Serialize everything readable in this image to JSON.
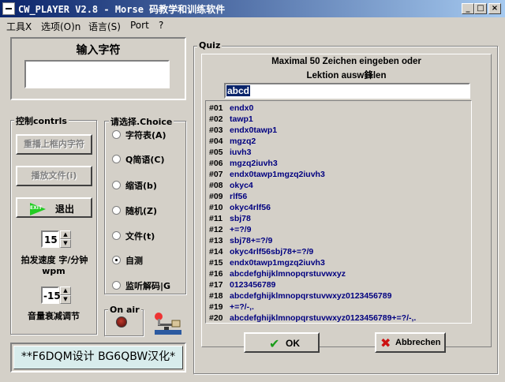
{
  "window": {
    "title": "CW_PLAYER  V2.8 - Morse 码教学和训练软件"
  },
  "menu": [
    "工具X",
    "选项(O)n",
    "语言(S)",
    "Port",
    "?"
  ],
  "input_panel": {
    "title": "输入字符",
    "value": ""
  },
  "control": {
    "title": "控制contrls",
    "repeat_button": "重播上框内字符",
    "play_file_button": "播放文件(i)",
    "exit_button": "退出",
    "exit_icon_text": "EXIT",
    "speed_value": "15",
    "speed_label": "拍发速度 字/分钟",
    "speed_unit": "wpm",
    "volume_value": "-15",
    "volume_label": "音量衰减调节"
  },
  "choice": {
    "title": "请选择.Choice",
    "options": [
      "字符表(A)",
      "Q简语(C)",
      "缩语(b)",
      "随机(Z)",
      "文件(t)",
      "自测",
      "监听解码|G"
    ],
    "selected_index": 5
  },
  "onair": {
    "title": "On air"
  },
  "footer": {
    "text": "**F6DQM设计 BG6QBW汉化*"
  },
  "quiz": {
    "title": "Quiz",
    "instruction_line1": "Maximal 50 Zeichen eingeben oder",
    "instruction_line2": "Lektion ausw鋒len",
    "input_value": "abcd",
    "lessons": [
      {
        "idx": "#01",
        "text": "endx0"
      },
      {
        "idx": "#02",
        "text": "tawp1"
      },
      {
        "idx": "#03",
        "text": "endx0tawp1"
      },
      {
        "idx": "#04",
        "text": "mgzq2"
      },
      {
        "idx": "#05",
        "text": "iuvh3"
      },
      {
        "idx": "#06",
        "text": "mgzq2iuvh3"
      },
      {
        "idx": "#07",
        "text": "endx0tawp1mgzq2iuvh3"
      },
      {
        "idx": "#08",
        "text": "okyc4"
      },
      {
        "idx": "#09",
        "text": "rlf56"
      },
      {
        "idx": "#10",
        "text": "okyc4rlf56"
      },
      {
        "idx": "#11",
        "text": "sbj78"
      },
      {
        "idx": "#12",
        "text": "+=?/9"
      },
      {
        "idx": "#13",
        "text": "sbj78+=?/9"
      },
      {
        "idx": "#14",
        "text": "okyc4rlf56sbj78+=?/9"
      },
      {
        "idx": "#15",
        "text": "endx0tawp1mgzq2iuvh3"
      },
      {
        "idx": "#16",
        "text": "abcdefghijklmnopqrstuvwxyz"
      },
      {
        "idx": "#17",
        "text": "0123456789"
      },
      {
        "idx": "#18",
        "text": "abcdefghijklmnopqrstuvwxyz0123456789"
      },
      {
        "idx": "#19",
        "text": "+=?/-,."
      },
      {
        "idx": "#20",
        "text": "abcdefghijklmnopqrstuvwxyz0123456789+=?/-,."
      }
    ],
    "ok_button": "OK",
    "cancel_button": "Abbrechen"
  }
}
